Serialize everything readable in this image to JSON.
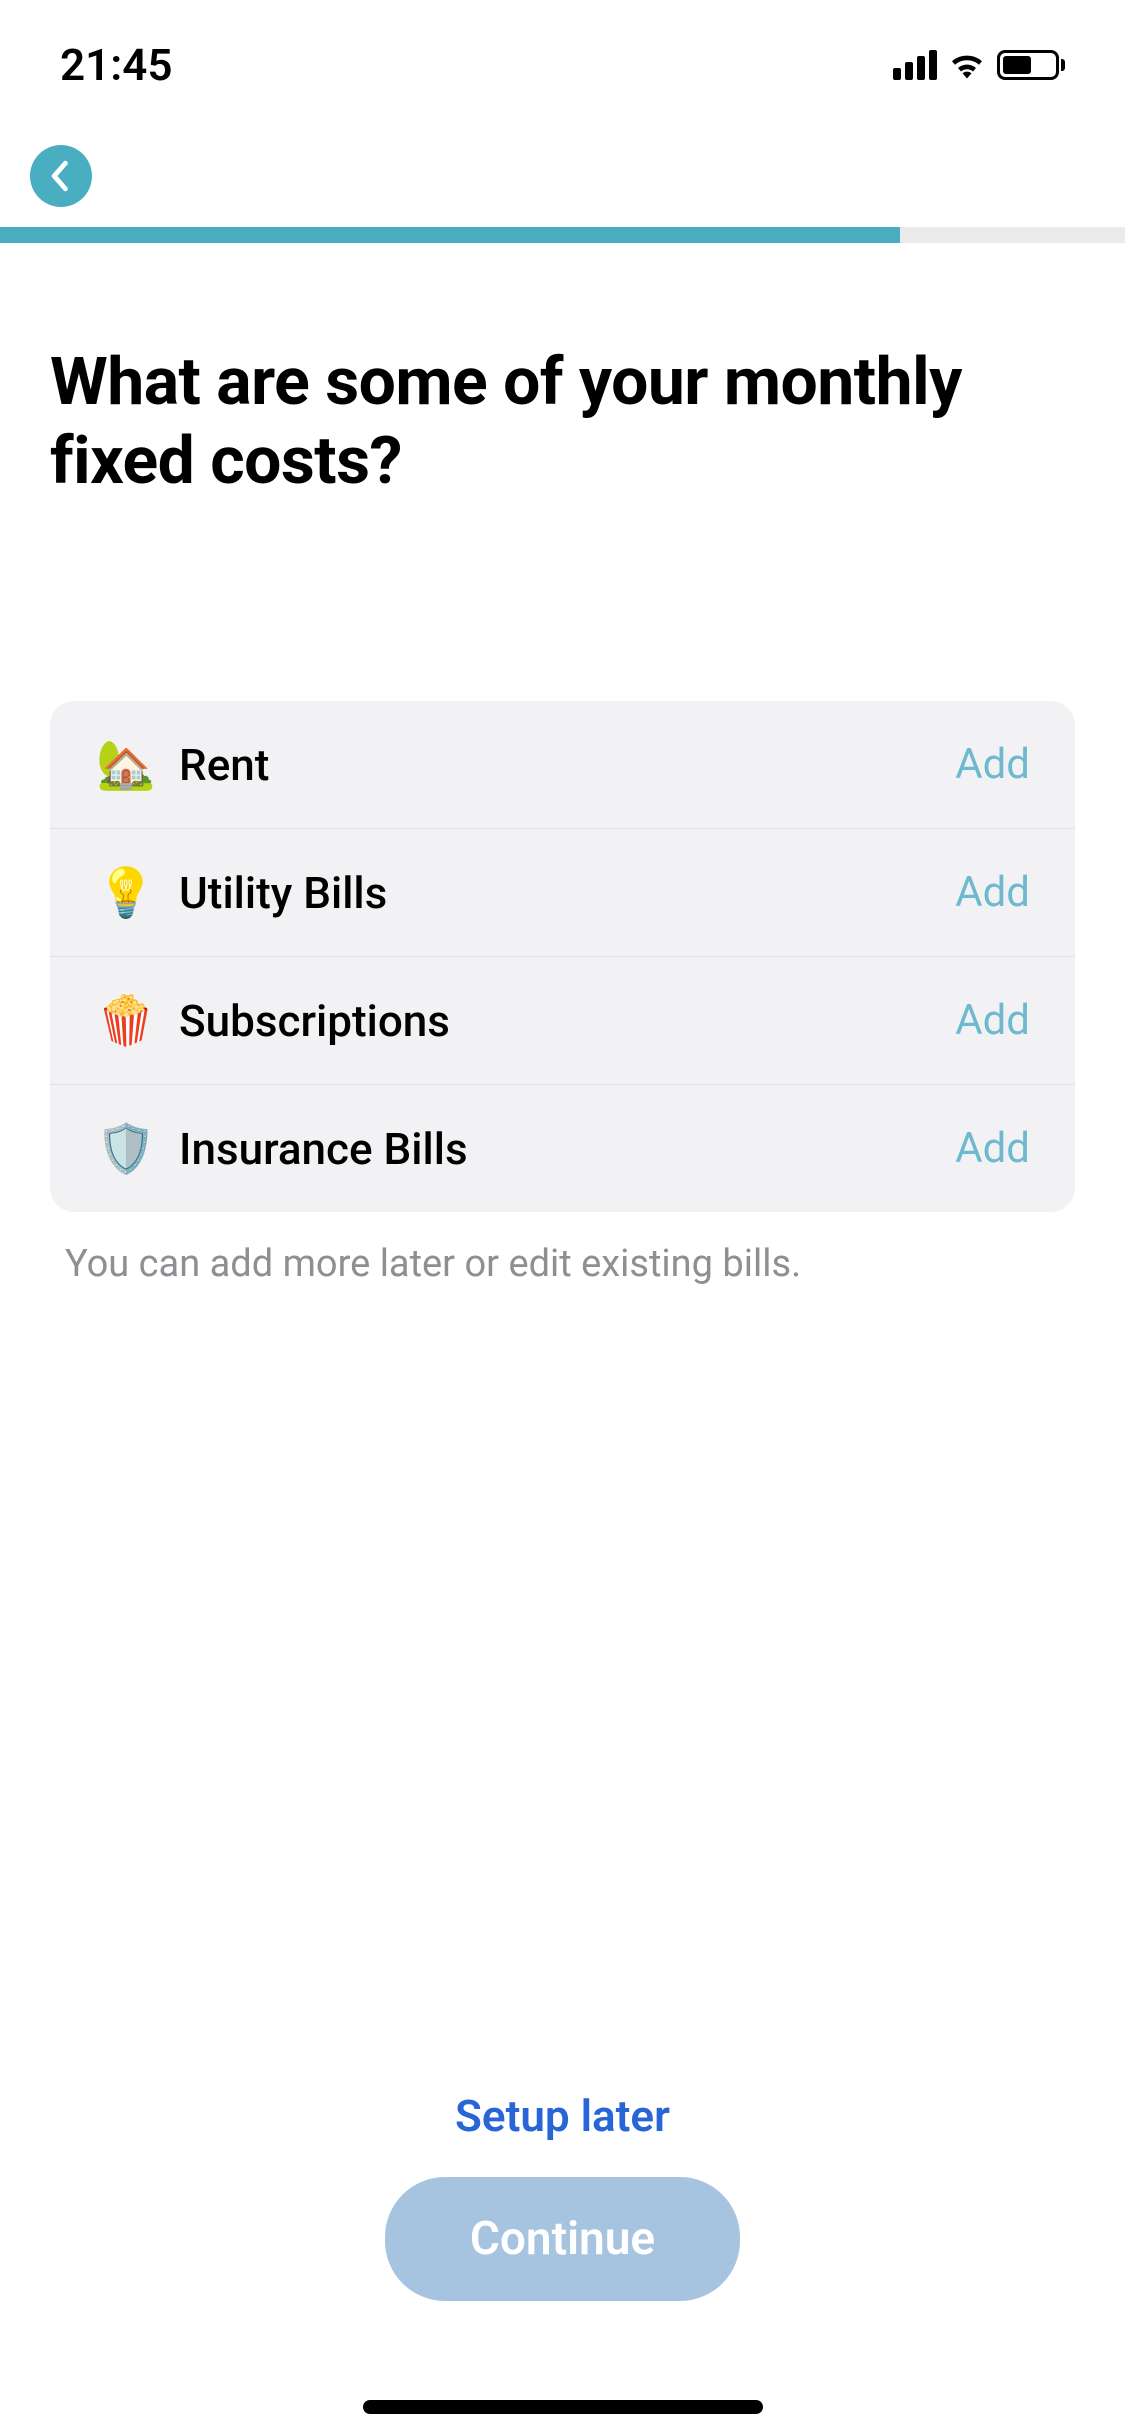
{
  "status": {
    "time": "21:45"
  },
  "page": {
    "title": "What are some of your monthly fixed costs?",
    "hint": "You can add more later or edit existing bills."
  },
  "items": [
    {
      "icon": "🏡",
      "label": "Rent",
      "action": "Add"
    },
    {
      "icon": "💡",
      "label": "Utility Bills",
      "action": "Add"
    },
    {
      "icon": "🍿",
      "label": "Subscriptions",
      "action": "Add"
    },
    {
      "icon": "🛡️",
      "label": "Insurance Bills",
      "action": "Add"
    }
  ],
  "footer": {
    "setup_later": "Setup later",
    "continue": "Continue"
  }
}
